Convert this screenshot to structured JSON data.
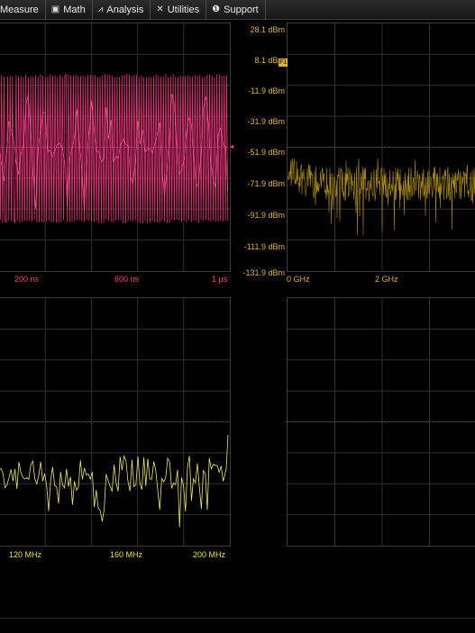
{
  "menu": [
    {
      "icon": "ruler-icon",
      "glyph": "",
      "label": "Measure"
    },
    {
      "icon": "calculator-icon",
      "glyph": "▣",
      "label": "Math"
    },
    {
      "icon": "analysis-chart-icon",
      "glyph": "⩘",
      "label": "Analysis"
    },
    {
      "icon": "wrench-icon",
      "glyph": "✕",
      "label": "Utilities"
    },
    {
      "icon": "info-icon",
      "glyph": "❶",
      "label": "Support"
    }
  ],
  "colors": {
    "time_trace": "#e8337a",
    "time_label": "#ff3b8e",
    "fft_trace": "#a88a14",
    "fft_label": "#e0b030",
    "zoom_trace": "#e8e860",
    "zoom_label": "#e8e040",
    "grid": "#303030"
  },
  "time_panel": {
    "x_labels": [
      "200 ns",
      "600 ns",
      "1 µs"
    ],
    "trigger_marker": "◂"
  },
  "fft_panel": {
    "channel_tag": "F1",
    "y_labels": [
      "28.1 dBm",
      "8.1 dBm",
      "-11.9 dBm",
      "-31.9 dBm",
      "-51.9 dBm",
      "-71.9 dBm",
      "-91.9 dBm",
      "-111.9 dBm",
      "-131.9 dBm"
    ],
    "x_labels": [
      "0 GHz",
      "2 GHz"
    ]
  },
  "zoom_panel": {
    "x_labels": [
      "120 MHz",
      "160 MHz",
      "200 MHz"
    ]
  },
  "chart_data": [
    {
      "type": "line",
      "description_source": "time domain trace",
      "x_ticks": [
        "200 ns",
        "600 ns",
        "1 µs"
      ],
      "series": [
        {
          "values_envelope": [
            1,
            -1
          ]
        }
      ]
    },
    {
      "type": "line",
      "x_ticks": [
        "0 GHz",
        "2 GHz"
      ],
      "y_ticks": [
        "28.1 dBm",
        "8.1 dBm",
        "-11.9 dBm",
        "-31.9 dBm",
        "-51.9 dBm",
        "-71.9 dBm",
        "-91.9 dBm",
        "-111.9 dBm",
        "-131.9 dBm"
      ],
      "ylim": [
        -131.9,
        28.1
      ],
      "noise_floor_dbm": -85
    },
    {
      "type": "line",
      "x_ticks": [
        "120 MHz",
        "160 MHz",
        "200 MHz"
      ]
    }
  ]
}
